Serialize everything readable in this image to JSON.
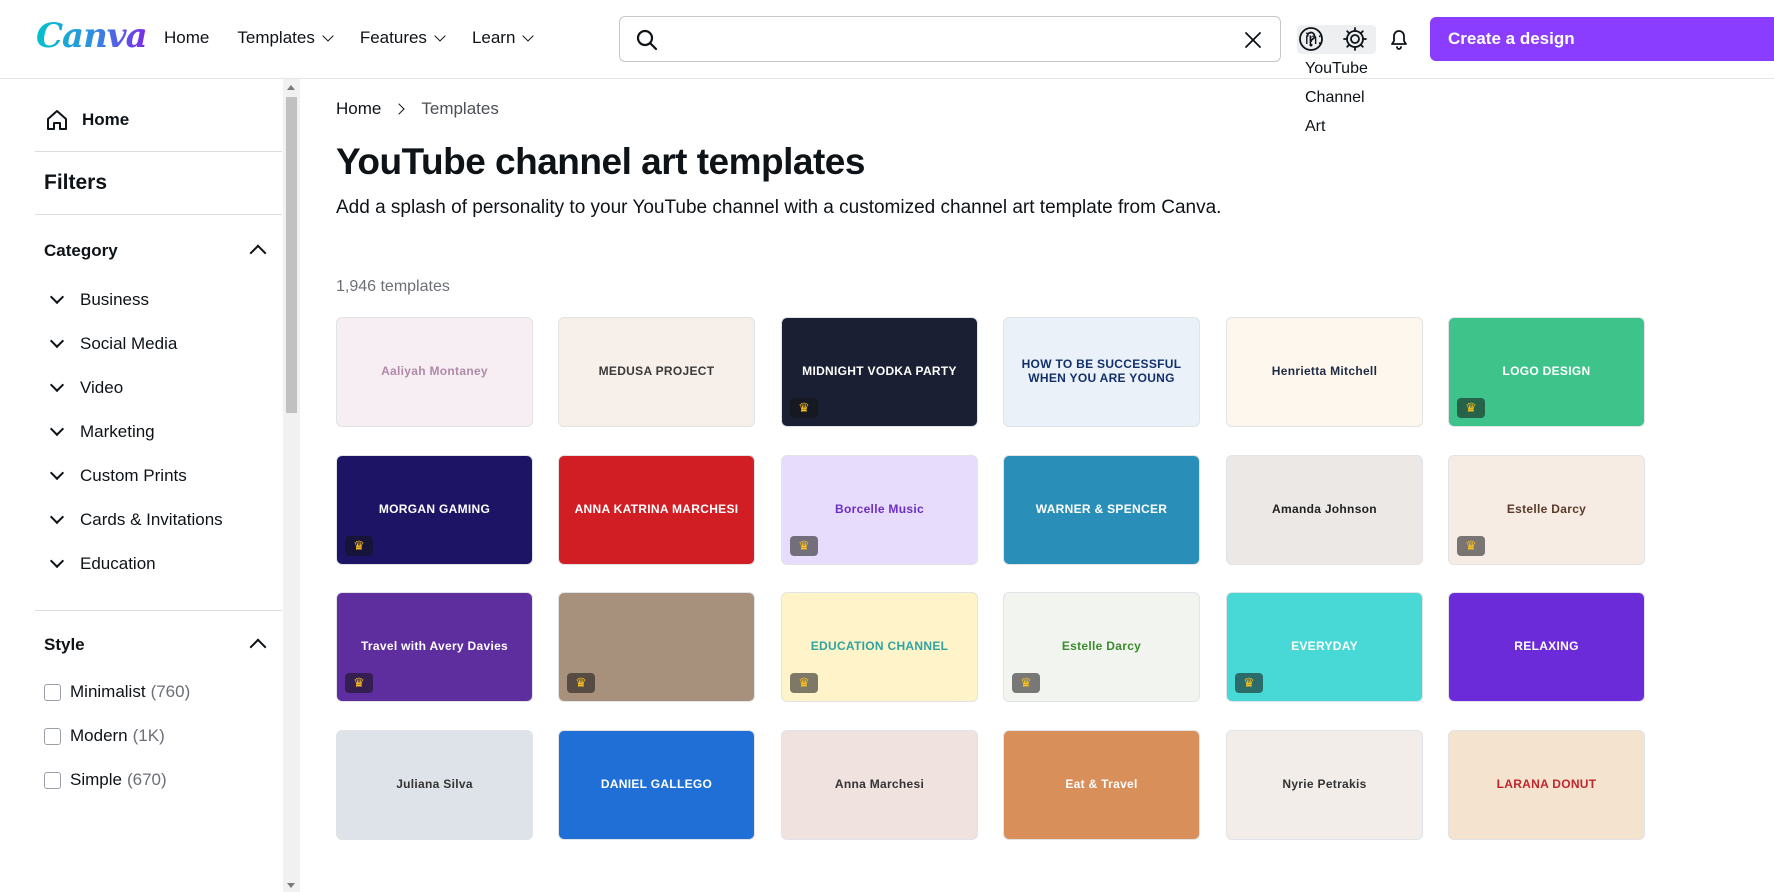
{
  "header": {
    "logo": "Canva",
    "nav": [
      {
        "label": "Home",
        "has_dropdown": false
      },
      {
        "label": "Templates",
        "has_dropdown": true
      },
      {
        "label": "Features",
        "has_dropdown": true
      },
      {
        "label": "Learn",
        "has_dropdown": true
      }
    ],
    "search": {
      "chip": "in: YouTube Channel Art",
      "icon": "search-icon",
      "clear_icon": "close-icon"
    },
    "icons": [
      "help-icon",
      "gear-icon",
      "bell-icon"
    ],
    "cta_label": "Create a design",
    "accent": "#8b3dff"
  },
  "sidebar": {
    "home_label": "Home",
    "filters_title": "Filters",
    "category": {
      "title": "Category",
      "items": [
        "Business",
        "Social Media",
        "Video",
        "Marketing",
        "Custom Prints",
        "Cards & Invitations",
        "Education"
      ]
    },
    "style": {
      "title": "Style",
      "items": [
        {
          "label": "Minimalist",
          "count": "(760)"
        },
        {
          "label": "Modern",
          "count": "(1K)"
        },
        {
          "label": "Simple",
          "count": "(670)"
        }
      ]
    }
  },
  "main": {
    "breadcrumb": [
      "Home",
      "Templates"
    ],
    "title": "YouTube channel art templates",
    "description": "Add a splash of personality to your YouTube channel with a customized channel art template from Canva.",
    "template_count": "1,946 templates",
    "templates": [
      {
        "text": "Aaliyah Montaney",
        "bg": "#f6eef3",
        "fg": "#b08aa8",
        "premium": false
      },
      {
        "text": "MEDUSA       PROJECT",
        "bg": "#f7efe9",
        "fg": "#3a3a3a",
        "premium": false
      },
      {
        "text": "MIDNIGHT VODKA PARTY",
        "bg": "#1b1f33",
        "fg": "#ffffff",
        "premium": true
      },
      {
        "text": "HOW TO BE SUCCESSFUL WHEN YOU ARE YOUNG",
        "bg": "#eaf1f8",
        "fg": "#13306b",
        "premium": false
      },
      {
        "text": "Henrietta Mitchell",
        "bg": "#fdf7ee",
        "fg": "#1f2a44",
        "premium": false
      },
      {
        "text": "LOGO DESIGN",
        "bg": "#3ec48b",
        "fg": "#ffffff",
        "premium": true
      },
      {
        "text": "MORGAN  GAMING",
        "bg": "#1d1466",
        "fg": "#ffffff",
        "premium": true
      },
      {
        "text": "ANNA KATRINA MARCHESI",
        "bg": "#d11e25",
        "fg": "#ffffff",
        "premium": false
      },
      {
        "text": "Borcelle Music",
        "bg": "#e7dcfb",
        "fg": "#6a2fc6",
        "premium": true
      },
      {
        "text": "WARNER & SPENCER",
        "bg": "#2a8fb8",
        "fg": "#ffffff",
        "premium": false
      },
      {
        "text": "Amanda Johnson",
        "bg": "#ebe8e6",
        "fg": "#222222",
        "premium": false
      },
      {
        "text": "Estelle Darcy",
        "bg": "#f7ece4",
        "fg": "#5a3a2a",
        "premium": true
      },
      {
        "text": "Travel with Avery Davies",
        "bg": "#5e2d9e",
        "fg": "#ffffff",
        "premium": true
      },
      {
        "text": "",
        "bg": "#a8917c",
        "fg": "#ffffff",
        "premium": true
      },
      {
        "text": "EDUCATION CHANNEL",
        "bg": "#fff3c9",
        "fg": "#2fa4a0",
        "premium": true
      },
      {
        "text": "Estelle Darcy",
        "bg": "#f2f4ef",
        "fg": "#3d8b2f",
        "premium": true
      },
      {
        "text": "EVERYDAY",
        "bg": "#48d8d6",
        "fg": "#ffffff",
        "premium": true
      },
      {
        "text": "RELAXING",
        "bg": "#6c2bd9",
        "fg": "#ffffff",
        "premium": false
      },
      {
        "text": "Juliana Silva",
        "bg": "#dde3e8",
        "fg": "#333333",
        "premium": false
      },
      {
        "text": "DANIEL GALLEGO",
        "bg": "#1f6fd6",
        "fg": "#ffffff",
        "premium": false
      },
      {
        "text": "Anna Marchesi",
        "bg": "#efe2df",
        "fg": "#333333",
        "premium": false
      },
      {
        "text": "Eat & Travel",
        "bg": "#d98f5a",
        "fg": "#ffffff",
        "premium": false
      },
      {
        "text": "Nyrie Petrakis",
        "bg": "#f2ede8",
        "fg": "#333333",
        "premium": false
      },
      {
        "text": "LARANA DONUT",
        "bg": "#f4e4cf",
        "fg": "#c0262d",
        "premium": false
      }
    ]
  }
}
